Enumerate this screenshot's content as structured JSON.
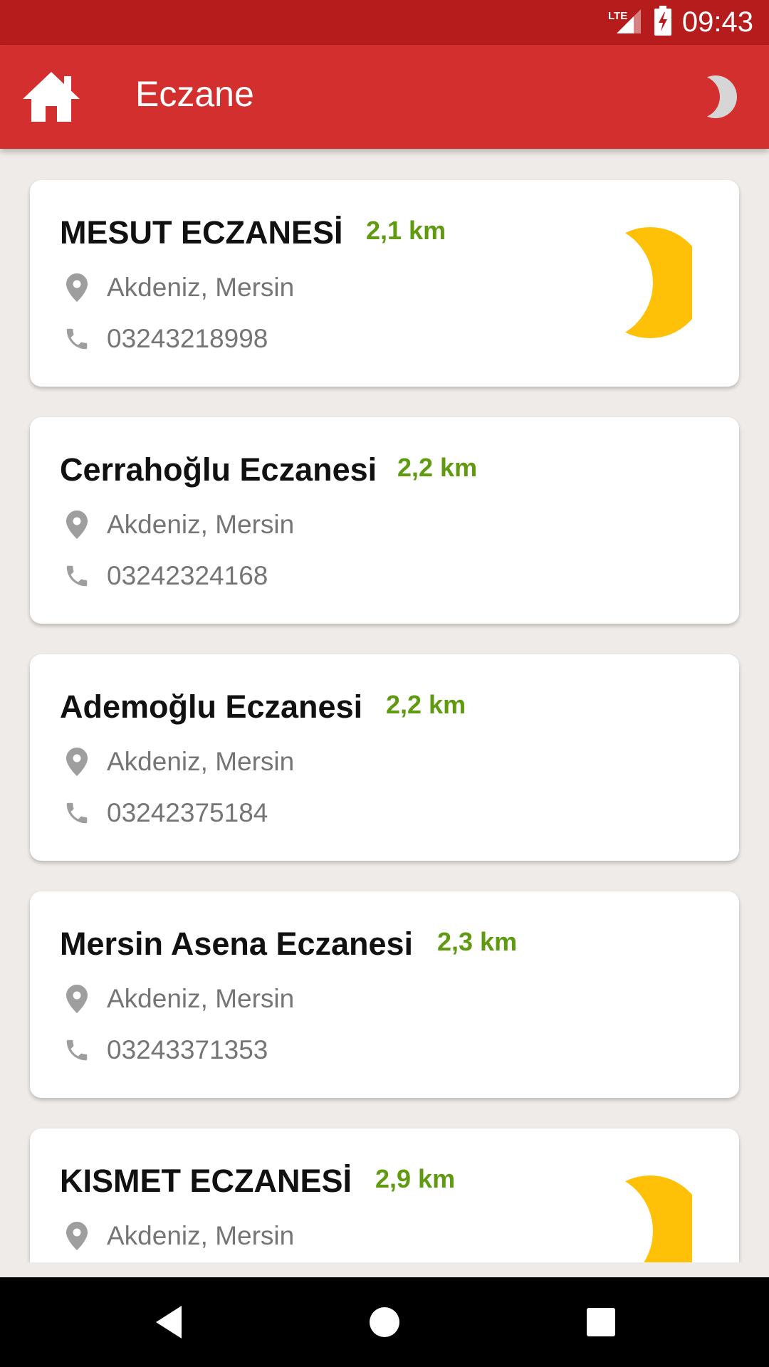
{
  "status_bar": {
    "network": "LTE",
    "time": "09:43"
  },
  "app_bar": {
    "title": "Eczane",
    "home_icon": "home-icon",
    "night_icon": "moon-icon"
  },
  "pharmacies": [
    {
      "name": "MESUT ECZANESİ",
      "distance": "2,1 km",
      "location": "Akdeniz, Mersin",
      "phone": "03243218998",
      "on_duty_night": true
    },
    {
      "name": "Cerrahoğlu Eczanesi",
      "distance": "2,2 km",
      "location": "Akdeniz, Mersin",
      "phone": "03242324168",
      "on_duty_night": false
    },
    {
      "name": "Ademoğlu Eczanesi",
      "distance": "2,2 km",
      "location": "Akdeniz, Mersin",
      "phone": "03242375184",
      "on_duty_night": false
    },
    {
      "name": "Mersin Asena Eczanesi",
      "distance": "2,3 km",
      "location": "Akdeniz, Mersin",
      "phone": "03243371353",
      "on_duty_night": false
    },
    {
      "name": "KISMET ECZANESİ",
      "distance": "2,9 km",
      "location": "Akdeniz, Mersin",
      "phone": "",
      "on_duty_night": true
    }
  ],
  "colors": {
    "status_bar": "#b71c1c",
    "app_bar": "#d32f2f",
    "distance": "#5f9a10",
    "moon": "#ffc107"
  }
}
